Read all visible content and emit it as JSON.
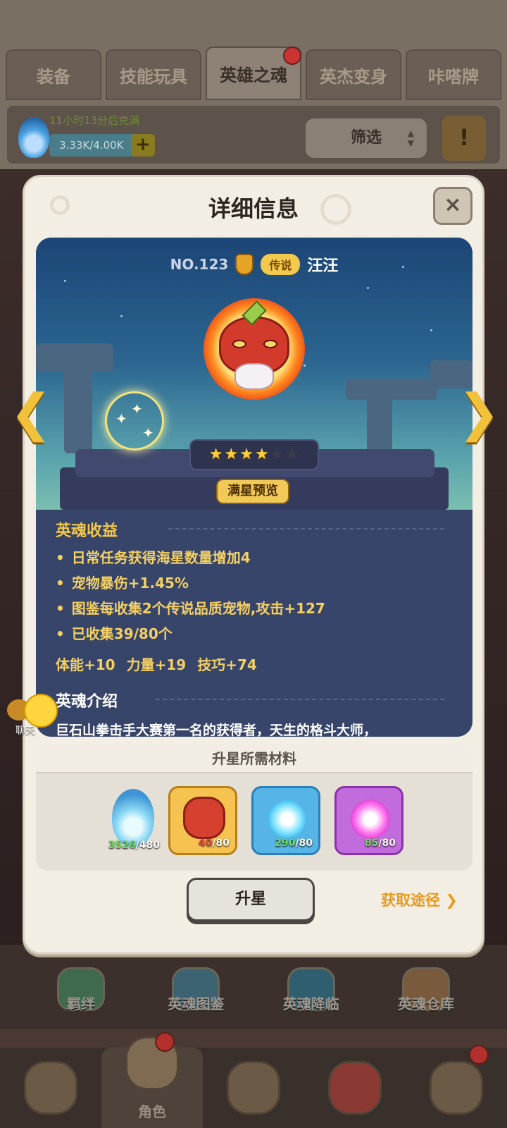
{
  "tabs": [
    {
      "label": "装备",
      "active": false
    },
    {
      "label": "技能玩具",
      "active": false
    },
    {
      "label": "英雄之魂",
      "active": true
    },
    {
      "label": "英杰变身",
      "active": false
    },
    {
      "label": "咔嗒牌",
      "active": false
    }
  ],
  "resource": {
    "refill_text": "11小时13分后充满",
    "energy": "3.33K/4.00K",
    "plus": "+",
    "filter_label": "筛选",
    "scroll_icon": "!"
  },
  "modal": {
    "title": "详细信息",
    "close": "×",
    "hero": {
      "number": "NO.123",
      "rarity": "传说",
      "name": "汪汪",
      "stars_on": 4,
      "stars_total": 6,
      "preview_label": "满星预览"
    },
    "bonus": {
      "title": "英魂收益",
      "items": [
        "日常任务获得海星数量增加4",
        "宠物暴伤+1.45%",
        "图鉴每收集2个传说品质宠物,攻击+127",
        "已收集39/80个"
      ],
      "stats": [
        "体能+10",
        "力量+19",
        "技巧+74"
      ]
    },
    "intro": {
      "title": "英魂介绍",
      "text": "巨石山拳击手大赛第一名的获得者，天生的格斗大师，"
    },
    "materials": {
      "title": "升星所需材料",
      "items": [
        {
          "icon": "blue-flame-icon",
          "have": "3526",
          "need": "/480",
          "enough": true
        },
        {
          "icon": "hero-fragment-icon",
          "have": "40",
          "need": "/80",
          "enough": false
        },
        {
          "icon": "blue-essence-icon",
          "have": "290",
          "need": "/80",
          "enough": true
        },
        {
          "icon": "purple-essence-icon",
          "have": "85",
          "need": "/80",
          "enough": true
        }
      ]
    },
    "upgrade_label": "升星",
    "source_label": "获取途径 ❯"
  },
  "chat": {
    "label": "聊天"
  },
  "features": [
    {
      "label": "羁绊",
      "icon": "bond-icon"
    },
    {
      "label": "英魂图鉴",
      "icon": "codex-icon"
    },
    {
      "label": "英魂降临",
      "icon": "summon-icon"
    },
    {
      "label": "英魂仓库",
      "icon": "storage-icon"
    }
  ],
  "bottom_nav": [
    {
      "label": "",
      "icon": "caveman-icon"
    },
    {
      "label": "角色",
      "icon": "character-icon",
      "active": true
    },
    {
      "label": "",
      "icon": "weapon-icon"
    },
    {
      "label": "",
      "icon": "pet-icon"
    },
    {
      "label": "",
      "icon": "totem-icon"
    }
  ],
  "colors": {
    "accent_gold": "#f2c94c",
    "panel_blue": "#37456a",
    "modal_bg": "#f3eee4",
    "link_orange": "#e79a1f"
  }
}
